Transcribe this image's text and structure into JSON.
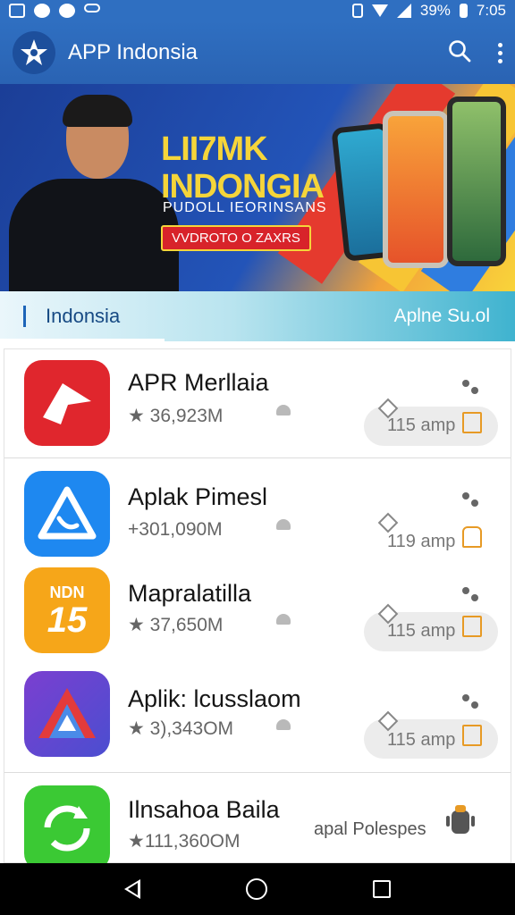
{
  "status_bar": {
    "battery_percent": "39%",
    "time": "7:05",
    "icons": [
      "gallery-icon",
      "chat-icon",
      "messenger-icon",
      "cloud-icon",
      "vibrate-icon",
      "wifi-icon",
      "signal-icon",
      "battery-icon"
    ]
  },
  "app_bar": {
    "title": "APP Indonsia",
    "logo_icon": "star-logo-icon",
    "search_icon": "search-icon",
    "menu_icon": "more-vert-icon"
  },
  "banner": {
    "headline_line1": "LII7MK",
    "headline_line2": "INDONGIA",
    "subline": "PUDOLL IEORINSANS",
    "badge": "VVDROTO O ZAXRS"
  },
  "tabs": {
    "left_label": "Indonsia",
    "right_label": "Aplne Su.ol"
  },
  "apps": [
    {
      "name": "APR Merllaia",
      "meta": "★ 36,923M",
      "action": "115 amp",
      "icon": "play-arrow-icon",
      "icon_color": "#e0262d",
      "has_pill": true,
      "action_icon": "share-icon"
    },
    {
      "name": "Aplak Pimesl",
      "meta": "+301,090M",
      "action": "119 amp",
      "icon": "triangle-phone-icon",
      "icon_color": "#1e88f0",
      "has_pill": false,
      "action_icon": "thumbs-up-icon"
    },
    {
      "name": "Mapralatilla",
      "meta": "★ 37,650M",
      "action": "115 amp",
      "icon": "ndn-15-icon",
      "icon_color": "#f6a619",
      "icon_text_top": "NDN",
      "icon_text_main": "15",
      "has_pill": true,
      "action_icon": "share-icon"
    },
    {
      "name": "Aplik: lcusslaom",
      "meta": "★ 3),343OM",
      "action": "115 amp",
      "icon": "prism-a-icon",
      "icon_color": "#6a3fc3",
      "has_pill": true,
      "action_icon": "share-icon"
    },
    {
      "name": "Ilnsahoa Baila",
      "meta": "★111,360OM",
      "action": "apal Polespes",
      "icon": "refresh-circle-icon",
      "icon_color": "#3bc934",
      "has_pill": false,
      "action_icon": "robot-icon"
    }
  ],
  "nav_bar": {
    "back_icon": "back-icon",
    "home_icon": "home-icon",
    "recents_icon": "recents-icon"
  }
}
